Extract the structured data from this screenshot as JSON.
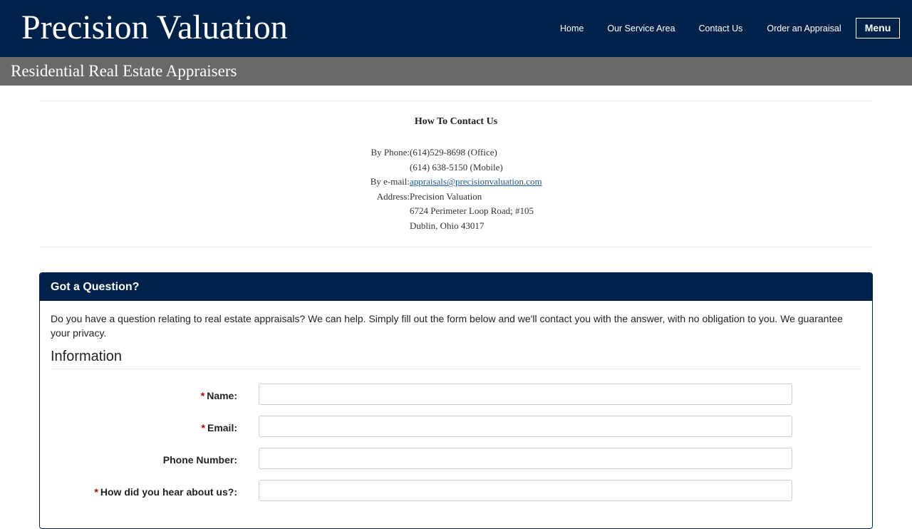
{
  "header": {
    "site_title": "Precision Valuation",
    "nav": [
      "Home",
      "Our Service Area",
      "Contact Us",
      "Order an Appraisal"
    ],
    "menu_label": "Menu",
    "tagline": "Residential Real Estate Appraisers"
  },
  "contact": {
    "heading": "How To Contact Us",
    "phone_label": "By Phone:",
    "phone_office": "(614)529-8698 (Office)",
    "phone_mobile": "(614) 638-5150 (Mobile)",
    "email_label": "By e-mail:",
    "email": "appraisals@precisionvaluation.com",
    "address_label": "Address:",
    "address_line1": "Precision Valuation",
    "address_line2": "6724 Perimeter Loop Road; #105",
    "address_line3": "Dublin, Ohio  43017"
  },
  "form": {
    "panel_title": "Got a Question?",
    "intro": "Do you have a question relating to real estate appraisals? We can help. Simply fill out the form below and we'll contact you with the answer, with no obligation to you. We guarantee your privacy.",
    "section_title": "Information",
    "required_marker": "*",
    "fields": {
      "name_label": "Name:",
      "email_label": "Email:",
      "phone_label": "Phone Number:",
      "referral_label": "How did you hear about us?:"
    }
  },
  "colors": {
    "header_bg": "#00224a",
    "subheader_bg": "#6a6868",
    "required": "#b30000",
    "link": "#1a5a96"
  }
}
